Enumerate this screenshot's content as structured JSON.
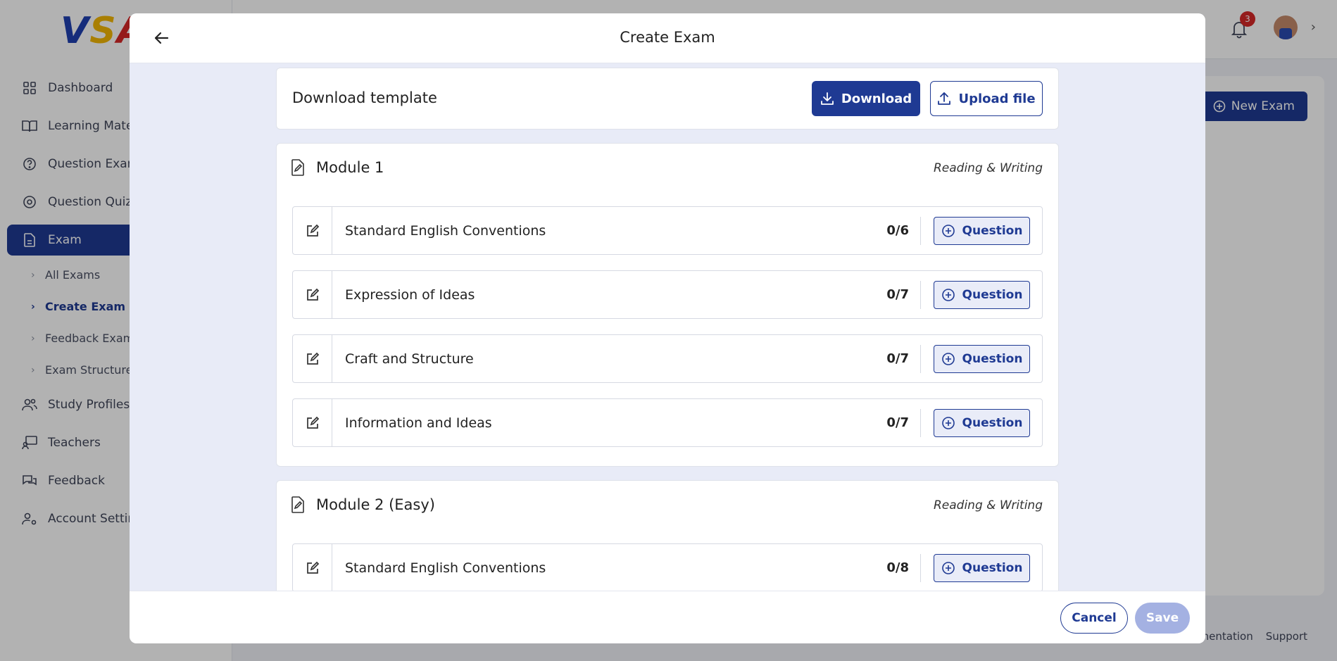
{
  "app": {
    "logo": {
      "v": "V",
      "s": "S",
      "a": "A"
    },
    "sidebar": {
      "items": [
        {
          "label": "Dashboard",
          "icon": "grid-icon"
        },
        {
          "label": "Learning Materials",
          "icon": "book-icon"
        },
        {
          "label": "Question Exam",
          "icon": "question-circle-icon"
        },
        {
          "label": "Question Quiz",
          "icon": "quiz-icon"
        },
        {
          "label": "Exam",
          "icon": "document-icon"
        },
        {
          "label": "Study Profiles",
          "icon": "users-icon"
        },
        {
          "label": "Teachers",
          "icon": "teacher-icon"
        },
        {
          "label": "Feedback",
          "icon": "chat-icon"
        },
        {
          "label": "Account Settings",
          "icon": "user-gear-icon"
        }
      ],
      "exam_sub": [
        {
          "label": "All Exams"
        },
        {
          "label": "Create Exam"
        },
        {
          "label": "Feedback Exam"
        },
        {
          "label": "Exam Structure"
        }
      ]
    },
    "notifications": {
      "count": "3"
    },
    "new_exam_label": "New Exam",
    "footer": {
      "documentation": "Documentation",
      "support": "Support"
    }
  },
  "modal": {
    "title": "Create Exam",
    "template": {
      "title": "Download template",
      "download_label": "Download",
      "upload_label": "Upload file"
    },
    "modules": [
      {
        "title": "Module 1",
        "subject": "Reading & Writing",
        "sections": [
          {
            "name": "Standard English Conventions",
            "count": "0/6",
            "button": "Question"
          },
          {
            "name": "Expression of Ideas",
            "count": "0/7",
            "button": "Question"
          },
          {
            "name": "Craft and Structure",
            "count": "0/7",
            "button": "Question"
          },
          {
            "name": "Information and Ideas",
            "count": "0/7",
            "button": "Question"
          }
        ]
      },
      {
        "title": "Module 2 (Easy)",
        "subject": "Reading & Writing",
        "sections": [
          {
            "name": "Standard English Conventions",
            "count": "0/8",
            "button": "Question"
          }
        ]
      }
    ],
    "footer": {
      "cancel": "Cancel",
      "save": "Save"
    }
  },
  "colors": {
    "primary": "#1f3a93",
    "save_disabled": "#a4b1e2",
    "badge": "#d62828"
  }
}
